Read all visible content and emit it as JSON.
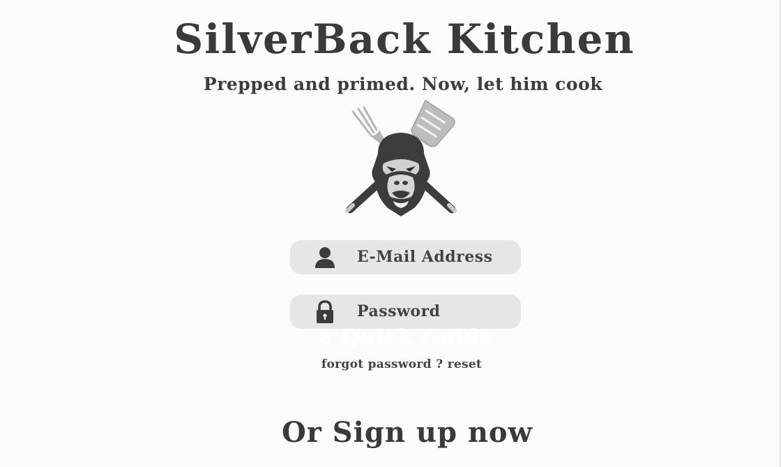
{
  "header": {
    "title": "SilverBack Kitchen",
    "tagline": "Prepped and primed. Now, let him cook"
  },
  "logo": {
    "icon": "gorilla-with-crossed-fork-and-spatula-icon"
  },
  "login_form": {
    "email": {
      "icon": "user-icon",
      "placeholder": "E-Mail Address",
      "value": ""
    },
    "password": {
      "icon": "lock-icon",
      "placeholder": "Password",
      "value": ""
    },
    "faded_text": "a Quick Guide",
    "forgot_password": {
      "prompt": "forgot password ?",
      "link": "reset"
    }
  },
  "signup": {
    "label": "Or Sign up now"
  },
  "colors": {
    "background": "#fbfbfb",
    "text": "#3a3a3a",
    "field_background": "#e6e6e6"
  }
}
